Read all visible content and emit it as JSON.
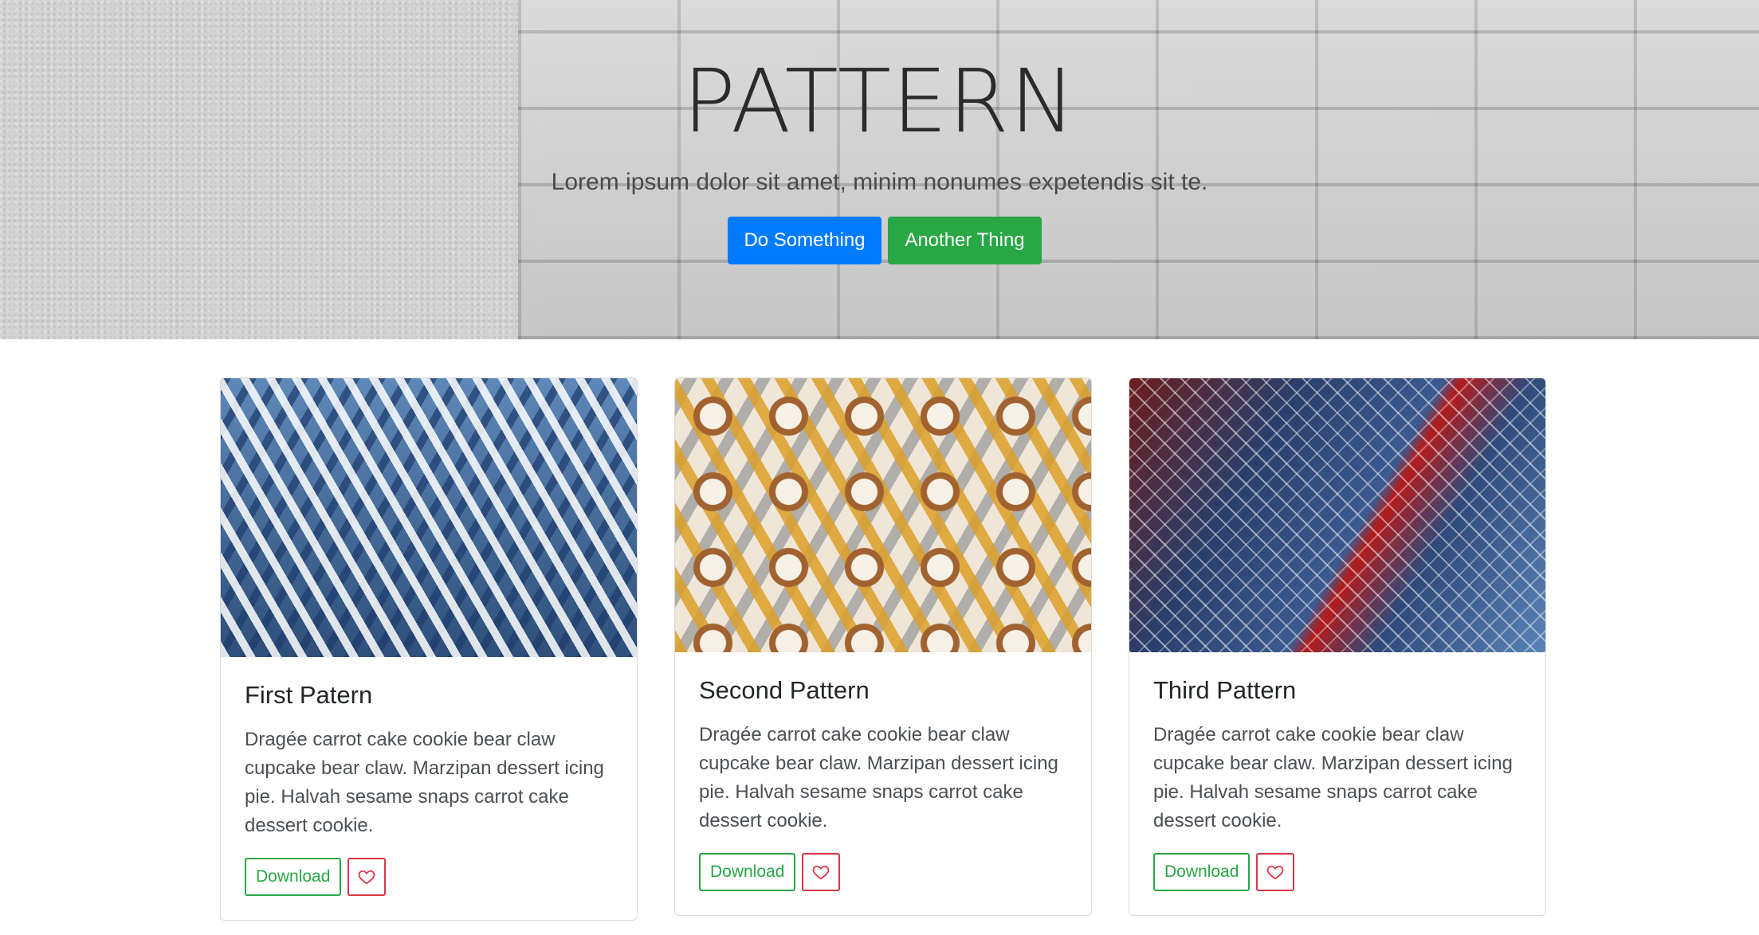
{
  "hero": {
    "title": "PATTERN",
    "subtitle": "Lorem ipsum dolor sit amet, minim nonumes expetendis sit te.",
    "primary_button": "Do Something",
    "secondary_button": "Another Thing"
  },
  "cards": [
    {
      "title": "First Patern",
      "text": "Dragée carrot cake cookie bear claw cupcake bear claw. Marzipan dessert icing pie. Halvah sesame snaps carrot cake dessert cookie.",
      "download_label": "Download",
      "image_icon": "diamond-pattern-image"
    },
    {
      "title": "Second Pattern",
      "text": "Dragée carrot cake cookie bear claw cupcake bear claw. Marzipan dessert icing pie. Halvah sesame snaps carrot cake dessert cookie.",
      "download_label": "Download",
      "image_icon": "islamic-tile-pattern-image"
    },
    {
      "title": "Third Pattern",
      "text": "Dragée carrot cake cookie bear claw cupcake bear claw. Marzipan dessert icing pie. Halvah sesame snaps carrot cake dessert cookie.",
      "download_label": "Download",
      "image_icon": "building-facade-pattern-image"
    }
  ],
  "colors": {
    "primary": "#007bff",
    "success": "#28a745",
    "danger": "#dc3545"
  }
}
